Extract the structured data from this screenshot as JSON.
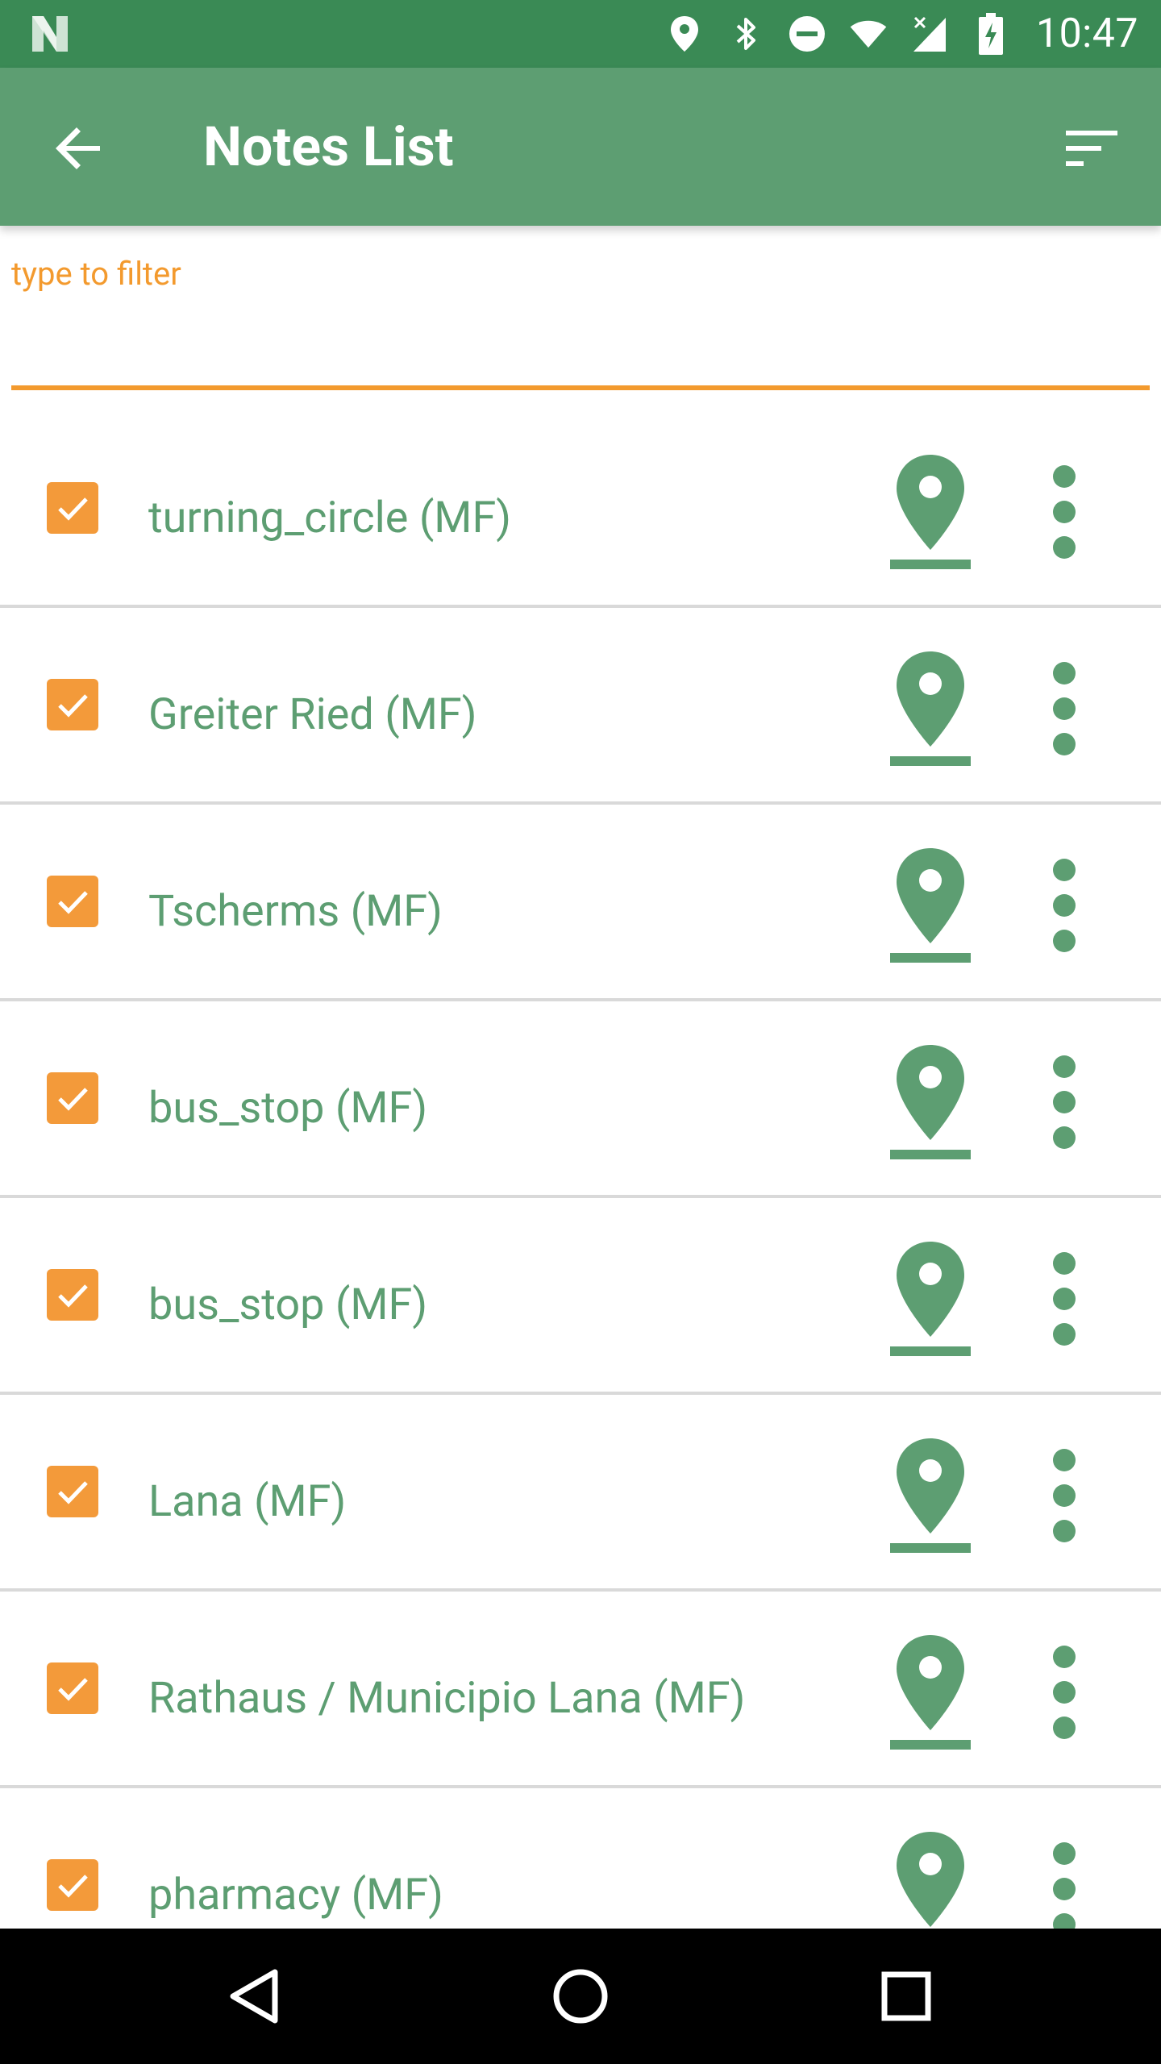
{
  "status_bar": {
    "time": "10:47",
    "icons": [
      "notification-n-icon",
      "location-icon",
      "bluetooth-icon",
      "do-not-disturb-icon",
      "wifi-icon",
      "signal-icon",
      "battery-charging-icon"
    ]
  },
  "app_bar": {
    "title": "Notes List",
    "back_icon": "arrow-back-icon",
    "sort_icon": "sort-icon"
  },
  "filter": {
    "label": "type to filter",
    "value": ""
  },
  "notes": [
    {
      "label": "turning_circle (MF)",
      "checked": true
    },
    {
      "label": "Greiter Ried (MF)",
      "checked": true
    },
    {
      "label": "Tscherms (MF)",
      "checked": true
    },
    {
      "label": "bus_stop (MF)",
      "checked": true
    },
    {
      "label": "bus_stop (MF)",
      "checked": true
    },
    {
      "label": "Lana (MF)",
      "checked": true
    },
    {
      "label": "Rathaus / Municipio Lana (MF)",
      "checked": true
    },
    {
      "label": "pharmacy (MF)",
      "checked": true
    }
  ],
  "colors": {
    "status_bar": "#3a8a55",
    "app_bar": "#5d9e72",
    "accent": "#f39a2e",
    "text_green": "#5d9e72"
  },
  "nav_bar": {
    "icons": [
      "nav-back-icon",
      "nav-home-icon",
      "nav-recents-icon"
    ]
  }
}
